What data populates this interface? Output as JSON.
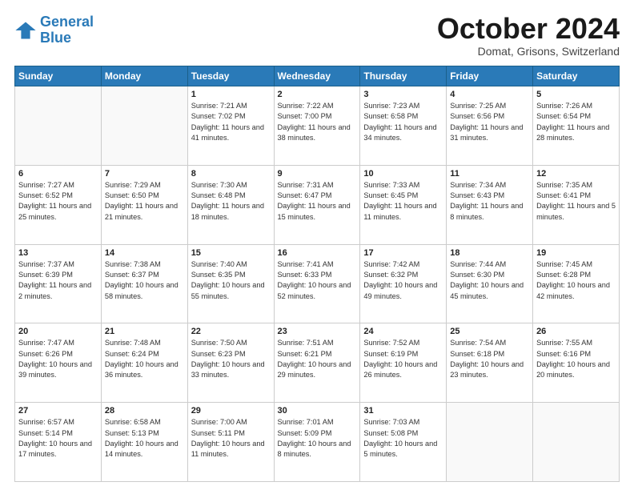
{
  "header": {
    "logo_general": "General",
    "logo_blue": "Blue",
    "month": "October 2024",
    "location": "Domat, Grisons, Switzerland"
  },
  "weekdays": [
    "Sunday",
    "Monday",
    "Tuesday",
    "Wednesday",
    "Thursday",
    "Friday",
    "Saturday"
  ],
  "weeks": [
    [
      {
        "num": "",
        "info": ""
      },
      {
        "num": "",
        "info": ""
      },
      {
        "num": "1",
        "info": "Sunrise: 7:21 AM\nSunset: 7:02 PM\nDaylight: 11 hours and 41 minutes."
      },
      {
        "num": "2",
        "info": "Sunrise: 7:22 AM\nSunset: 7:00 PM\nDaylight: 11 hours and 38 minutes."
      },
      {
        "num": "3",
        "info": "Sunrise: 7:23 AM\nSunset: 6:58 PM\nDaylight: 11 hours and 34 minutes."
      },
      {
        "num": "4",
        "info": "Sunrise: 7:25 AM\nSunset: 6:56 PM\nDaylight: 11 hours and 31 minutes."
      },
      {
        "num": "5",
        "info": "Sunrise: 7:26 AM\nSunset: 6:54 PM\nDaylight: 11 hours and 28 minutes."
      }
    ],
    [
      {
        "num": "6",
        "info": "Sunrise: 7:27 AM\nSunset: 6:52 PM\nDaylight: 11 hours and 25 minutes."
      },
      {
        "num": "7",
        "info": "Sunrise: 7:29 AM\nSunset: 6:50 PM\nDaylight: 11 hours and 21 minutes."
      },
      {
        "num": "8",
        "info": "Sunrise: 7:30 AM\nSunset: 6:48 PM\nDaylight: 11 hours and 18 minutes."
      },
      {
        "num": "9",
        "info": "Sunrise: 7:31 AM\nSunset: 6:47 PM\nDaylight: 11 hours and 15 minutes."
      },
      {
        "num": "10",
        "info": "Sunrise: 7:33 AM\nSunset: 6:45 PM\nDaylight: 11 hours and 11 minutes."
      },
      {
        "num": "11",
        "info": "Sunrise: 7:34 AM\nSunset: 6:43 PM\nDaylight: 11 hours and 8 minutes."
      },
      {
        "num": "12",
        "info": "Sunrise: 7:35 AM\nSunset: 6:41 PM\nDaylight: 11 hours and 5 minutes."
      }
    ],
    [
      {
        "num": "13",
        "info": "Sunrise: 7:37 AM\nSunset: 6:39 PM\nDaylight: 11 hours and 2 minutes."
      },
      {
        "num": "14",
        "info": "Sunrise: 7:38 AM\nSunset: 6:37 PM\nDaylight: 10 hours and 58 minutes."
      },
      {
        "num": "15",
        "info": "Sunrise: 7:40 AM\nSunset: 6:35 PM\nDaylight: 10 hours and 55 minutes."
      },
      {
        "num": "16",
        "info": "Sunrise: 7:41 AM\nSunset: 6:33 PM\nDaylight: 10 hours and 52 minutes."
      },
      {
        "num": "17",
        "info": "Sunrise: 7:42 AM\nSunset: 6:32 PM\nDaylight: 10 hours and 49 minutes."
      },
      {
        "num": "18",
        "info": "Sunrise: 7:44 AM\nSunset: 6:30 PM\nDaylight: 10 hours and 45 minutes."
      },
      {
        "num": "19",
        "info": "Sunrise: 7:45 AM\nSunset: 6:28 PM\nDaylight: 10 hours and 42 minutes."
      }
    ],
    [
      {
        "num": "20",
        "info": "Sunrise: 7:47 AM\nSunset: 6:26 PM\nDaylight: 10 hours and 39 minutes."
      },
      {
        "num": "21",
        "info": "Sunrise: 7:48 AM\nSunset: 6:24 PM\nDaylight: 10 hours and 36 minutes."
      },
      {
        "num": "22",
        "info": "Sunrise: 7:50 AM\nSunset: 6:23 PM\nDaylight: 10 hours and 33 minutes."
      },
      {
        "num": "23",
        "info": "Sunrise: 7:51 AM\nSunset: 6:21 PM\nDaylight: 10 hours and 29 minutes."
      },
      {
        "num": "24",
        "info": "Sunrise: 7:52 AM\nSunset: 6:19 PM\nDaylight: 10 hours and 26 minutes."
      },
      {
        "num": "25",
        "info": "Sunrise: 7:54 AM\nSunset: 6:18 PM\nDaylight: 10 hours and 23 minutes."
      },
      {
        "num": "26",
        "info": "Sunrise: 7:55 AM\nSunset: 6:16 PM\nDaylight: 10 hours and 20 minutes."
      }
    ],
    [
      {
        "num": "27",
        "info": "Sunrise: 6:57 AM\nSunset: 5:14 PM\nDaylight: 10 hours and 17 minutes."
      },
      {
        "num": "28",
        "info": "Sunrise: 6:58 AM\nSunset: 5:13 PM\nDaylight: 10 hours and 14 minutes."
      },
      {
        "num": "29",
        "info": "Sunrise: 7:00 AM\nSunset: 5:11 PM\nDaylight: 10 hours and 11 minutes."
      },
      {
        "num": "30",
        "info": "Sunrise: 7:01 AM\nSunset: 5:09 PM\nDaylight: 10 hours and 8 minutes."
      },
      {
        "num": "31",
        "info": "Sunrise: 7:03 AM\nSunset: 5:08 PM\nDaylight: 10 hours and 5 minutes."
      },
      {
        "num": "",
        "info": ""
      },
      {
        "num": "",
        "info": ""
      }
    ]
  ]
}
